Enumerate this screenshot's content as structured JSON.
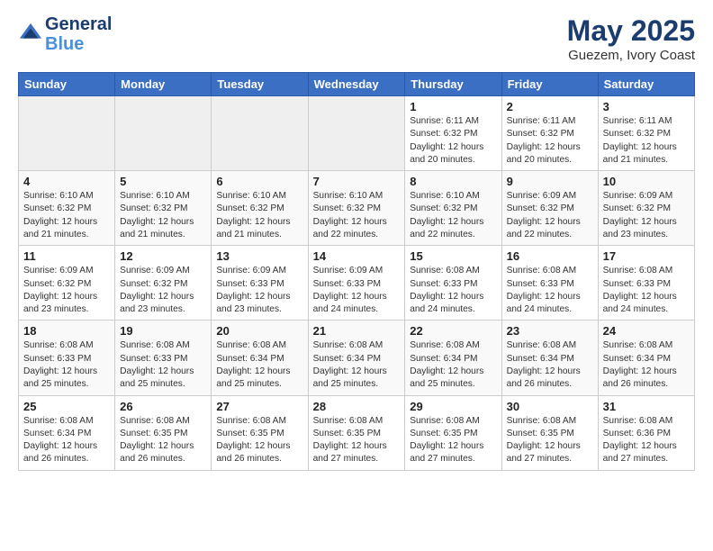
{
  "header": {
    "logo_line1": "General",
    "logo_line2": "Blue",
    "month_year": "May 2025",
    "location": "Guezem, Ivory Coast"
  },
  "days_of_week": [
    "Sunday",
    "Monday",
    "Tuesday",
    "Wednesday",
    "Thursday",
    "Friday",
    "Saturday"
  ],
  "weeks": [
    [
      {
        "day": "",
        "text": ""
      },
      {
        "day": "",
        "text": ""
      },
      {
        "day": "",
        "text": ""
      },
      {
        "day": "",
        "text": ""
      },
      {
        "day": "1",
        "text": "Sunrise: 6:11 AM\nSunset: 6:32 PM\nDaylight: 12 hours\nand 20 minutes."
      },
      {
        "day": "2",
        "text": "Sunrise: 6:11 AM\nSunset: 6:32 PM\nDaylight: 12 hours\nand 20 minutes."
      },
      {
        "day": "3",
        "text": "Sunrise: 6:11 AM\nSunset: 6:32 PM\nDaylight: 12 hours\nand 21 minutes."
      }
    ],
    [
      {
        "day": "4",
        "text": "Sunrise: 6:10 AM\nSunset: 6:32 PM\nDaylight: 12 hours\nand 21 minutes."
      },
      {
        "day": "5",
        "text": "Sunrise: 6:10 AM\nSunset: 6:32 PM\nDaylight: 12 hours\nand 21 minutes."
      },
      {
        "day": "6",
        "text": "Sunrise: 6:10 AM\nSunset: 6:32 PM\nDaylight: 12 hours\nand 21 minutes."
      },
      {
        "day": "7",
        "text": "Sunrise: 6:10 AM\nSunset: 6:32 PM\nDaylight: 12 hours\nand 22 minutes."
      },
      {
        "day": "8",
        "text": "Sunrise: 6:10 AM\nSunset: 6:32 PM\nDaylight: 12 hours\nand 22 minutes."
      },
      {
        "day": "9",
        "text": "Sunrise: 6:09 AM\nSunset: 6:32 PM\nDaylight: 12 hours\nand 22 minutes."
      },
      {
        "day": "10",
        "text": "Sunrise: 6:09 AM\nSunset: 6:32 PM\nDaylight: 12 hours\nand 23 minutes."
      }
    ],
    [
      {
        "day": "11",
        "text": "Sunrise: 6:09 AM\nSunset: 6:32 PM\nDaylight: 12 hours\nand 23 minutes."
      },
      {
        "day": "12",
        "text": "Sunrise: 6:09 AM\nSunset: 6:32 PM\nDaylight: 12 hours\nand 23 minutes."
      },
      {
        "day": "13",
        "text": "Sunrise: 6:09 AM\nSunset: 6:33 PM\nDaylight: 12 hours\nand 23 minutes."
      },
      {
        "day": "14",
        "text": "Sunrise: 6:09 AM\nSunset: 6:33 PM\nDaylight: 12 hours\nand 24 minutes."
      },
      {
        "day": "15",
        "text": "Sunrise: 6:08 AM\nSunset: 6:33 PM\nDaylight: 12 hours\nand 24 minutes."
      },
      {
        "day": "16",
        "text": "Sunrise: 6:08 AM\nSunset: 6:33 PM\nDaylight: 12 hours\nand 24 minutes."
      },
      {
        "day": "17",
        "text": "Sunrise: 6:08 AM\nSunset: 6:33 PM\nDaylight: 12 hours\nand 24 minutes."
      }
    ],
    [
      {
        "day": "18",
        "text": "Sunrise: 6:08 AM\nSunset: 6:33 PM\nDaylight: 12 hours\nand 25 minutes."
      },
      {
        "day": "19",
        "text": "Sunrise: 6:08 AM\nSunset: 6:33 PM\nDaylight: 12 hours\nand 25 minutes."
      },
      {
        "day": "20",
        "text": "Sunrise: 6:08 AM\nSunset: 6:34 PM\nDaylight: 12 hours\nand 25 minutes."
      },
      {
        "day": "21",
        "text": "Sunrise: 6:08 AM\nSunset: 6:34 PM\nDaylight: 12 hours\nand 25 minutes."
      },
      {
        "day": "22",
        "text": "Sunrise: 6:08 AM\nSunset: 6:34 PM\nDaylight: 12 hours\nand 25 minutes."
      },
      {
        "day": "23",
        "text": "Sunrise: 6:08 AM\nSunset: 6:34 PM\nDaylight: 12 hours\nand 26 minutes."
      },
      {
        "day": "24",
        "text": "Sunrise: 6:08 AM\nSunset: 6:34 PM\nDaylight: 12 hours\nand 26 minutes."
      }
    ],
    [
      {
        "day": "25",
        "text": "Sunrise: 6:08 AM\nSunset: 6:34 PM\nDaylight: 12 hours\nand 26 minutes."
      },
      {
        "day": "26",
        "text": "Sunrise: 6:08 AM\nSunset: 6:35 PM\nDaylight: 12 hours\nand 26 minutes."
      },
      {
        "day": "27",
        "text": "Sunrise: 6:08 AM\nSunset: 6:35 PM\nDaylight: 12 hours\nand 26 minutes."
      },
      {
        "day": "28",
        "text": "Sunrise: 6:08 AM\nSunset: 6:35 PM\nDaylight: 12 hours\nand 27 minutes."
      },
      {
        "day": "29",
        "text": "Sunrise: 6:08 AM\nSunset: 6:35 PM\nDaylight: 12 hours\nand 27 minutes."
      },
      {
        "day": "30",
        "text": "Sunrise: 6:08 AM\nSunset: 6:35 PM\nDaylight: 12 hours\nand 27 minutes."
      },
      {
        "day": "31",
        "text": "Sunrise: 6:08 AM\nSunset: 6:36 PM\nDaylight: 12 hours\nand 27 minutes."
      }
    ]
  ]
}
